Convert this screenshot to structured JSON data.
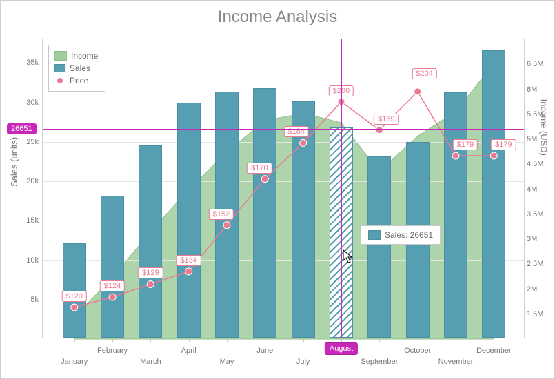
{
  "title": "Income Analysis",
  "axes": {
    "left_title": "Sales (units)",
    "right_title": "Income (USD)"
  },
  "left_scale": {
    "min": 0,
    "max": 38000
  },
  "right_scale": {
    "min": 1000000,
    "max": 7000000
  },
  "left_ticks": [
    {
      "val": 5000,
      "label": "5k"
    },
    {
      "val": 10000,
      "label": "10k"
    },
    {
      "val": 15000,
      "label": "15k"
    },
    {
      "val": 20000,
      "label": "20k"
    },
    {
      "val": 25000,
      "label": "25k"
    },
    {
      "val": 30000,
      "label": "30k"
    },
    {
      "val": 35000,
      "label": "35k"
    }
  ],
  "right_ticks": [
    {
      "val": 1500000,
      "label": "1.5M"
    },
    {
      "val": 2000000,
      "label": "2M"
    },
    {
      "val": 2500000,
      "label": "2.5M"
    },
    {
      "val": 3000000,
      "label": "3M"
    },
    {
      "val": 3500000,
      "label": "3.5M"
    },
    {
      "val": 4000000,
      "label": "4M"
    },
    {
      "val": 4500000,
      "label": "4.5M"
    },
    {
      "val": 5000000,
      "label": "5M"
    },
    {
      "val": 5500000,
      "label": "5.5M"
    },
    {
      "val": 6000000,
      "label": "6M"
    },
    {
      "val": 6500000,
      "label": "6.5M"
    }
  ],
  "legend": {
    "income": "Income",
    "sales": "Sales",
    "price": "Price"
  },
  "crosshair": {
    "month_index": 7,
    "value": 26651,
    "y_label": "26651"
  },
  "tooltip": {
    "text": "Sales: 26651"
  },
  "chart_data": {
    "type": "bar",
    "title": "Income Analysis",
    "xlabel": "",
    "ylabel_left": "Sales (units)",
    "ylabel_right": "Income (USD)",
    "ylim_left": [
      0,
      38000
    ],
    "ylim_right": [
      1000000,
      7000000
    ],
    "categories": [
      "January",
      "February",
      "March",
      "April",
      "May",
      "June",
      "July",
      "August",
      "September",
      "October",
      "November",
      "December"
    ],
    "series": [
      {
        "name": "Income",
        "type": "area",
        "axis": "right",
        "values": [
          1440000,
          2232000,
          3149600,
          3993200,
          4742400,
          5372000,
          5520000,
          5330200,
          4350600,
          5059600,
          5556900,
          6513600
        ]
      },
      {
        "name": "Sales",
        "type": "bar",
        "axis": "left",
        "values": [
          12000,
          18000,
          24400,
          29800,
          31200,
          31600,
          30000,
          26651,
          23000,
          24800,
          31100,
          36400
        ]
      },
      {
        "name": "Price",
        "type": "line",
        "axis": "left_as_dollars",
        "values": [
          120,
          124,
          129,
          134,
          152,
          170,
          184,
          200,
          189,
          204,
          179,
          179
        ],
        "labels": [
          "$120",
          "$124",
          "$129",
          "$134",
          "$152",
          "$170",
          "$184",
          "$200",
          "$189",
          "$204",
          "$179",
          "$179"
        ]
      }
    ]
  }
}
